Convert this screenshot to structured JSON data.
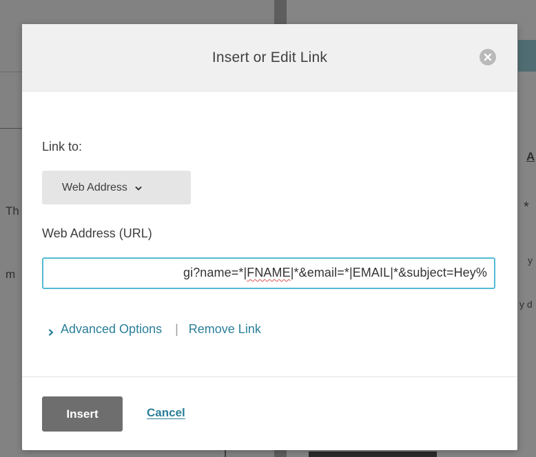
{
  "background": {
    "fragments": [
      "Th",
      "m",
      "A",
      "*",
      "y",
      "y d"
    ]
  },
  "dialog": {
    "title": "Insert or Edit Link",
    "close_icon": "close-circle-icon",
    "link_to_label": "Link to:",
    "link_type": {
      "selected": "Web Address",
      "icon": "chevron-down-icon"
    },
    "url_label": "Web Address (URL)",
    "url_value_visible_before": "gi?name=*|",
    "url_value_visible_squiggle": "FNAME",
    "url_value_visible_after": "|*&email=*|EMAIL|*&subject=Hey%",
    "advanced_options_label": "Advanced Options",
    "separator": "|",
    "remove_link_label": "Remove Link",
    "insert_label": "Insert",
    "cancel_label": "Cancel"
  },
  "colors": {
    "accent_link": "#2b7f99",
    "focus_border": "#52bad5",
    "primary_button": "#6e6e6e"
  }
}
